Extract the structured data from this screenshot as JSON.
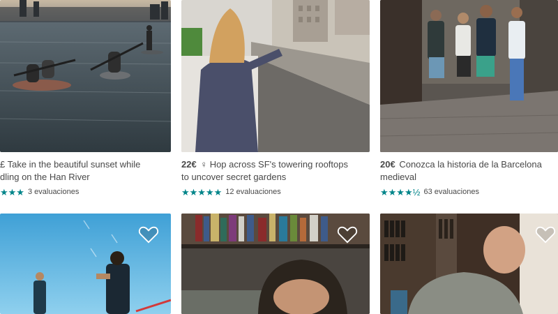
{
  "listings": [
    {
      "price": "",
      "title_line1": "£ Take in the beautiful sunset while",
      "title_line2": "dling on the Han River",
      "stars_text": "★★★",
      "reviews": "3 evaluaciones"
    },
    {
      "price": "22€",
      "title_line1": "♀ Hop across SF's towering rooftops",
      "title_line2": "to uncover secret gardens",
      "stars_text": "★★★★★",
      "reviews": "12 evaluaciones"
    },
    {
      "price": "20€",
      "title_line1": "Conozca la historia de la Barcelona",
      "title_line2": "medieval",
      "stars_text": "★★★★½",
      "reviews": "63 evaluaciones"
    }
  ],
  "colors": {
    "star": "#008489",
    "text": "#484848"
  },
  "icons": {
    "favorite": "heart-outline-icon",
    "rating": "star-icon"
  }
}
